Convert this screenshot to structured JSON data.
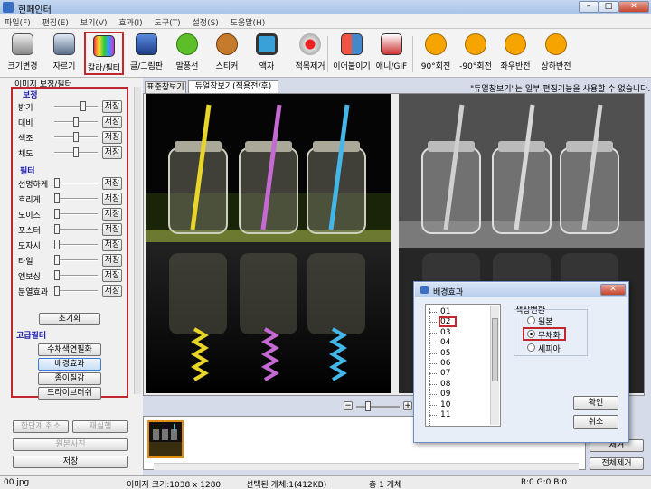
{
  "window": {
    "title": "헌페인터"
  },
  "menu": [
    "파일(F)",
    "편집(E)",
    "보기(V)",
    "효과(I)",
    "도구(T)",
    "설정(S)",
    "도움말(H)"
  ],
  "toolbar": [
    {
      "label": "크기변경",
      "icon": "resize-icon"
    },
    {
      "label": "자르기",
      "icon": "crop-icon"
    },
    {
      "label": "칼라/필터",
      "icon": "color-filter-icon"
    },
    {
      "label": "글/그림판",
      "icon": "text-draw-icon"
    },
    {
      "label": "말풍선",
      "icon": "speech-bubble-icon"
    },
    {
      "label": "스티커",
      "icon": "sticker-icon"
    },
    {
      "label": "액자",
      "icon": "frame-icon"
    },
    {
      "label": "적목제거",
      "icon": "red-eye-icon"
    },
    {
      "label": "이어붙이기",
      "icon": "merge-icon"
    },
    {
      "label": "애니/GIF",
      "icon": "gif-icon"
    },
    {
      "label": "90°회전",
      "icon": "rotate-cw-icon"
    },
    {
      "label": "-90°회전",
      "icon": "rotate-ccw-icon"
    },
    {
      "label": "좌우반전",
      "icon": "flip-h-icon"
    },
    {
      "label": "상하반전",
      "icon": "flip-v-icon"
    }
  ],
  "left_panel": {
    "header": "이미지 보정/필터",
    "correction_title": "보정",
    "correction": [
      {
        "label": "밝기",
        "level": 0.7
      },
      {
        "label": "대비",
        "level": 0.5
      },
      {
        "label": "색조",
        "level": 0.5
      },
      {
        "label": "채도",
        "level": 0.5
      }
    ],
    "filter_title": "필터",
    "filters": [
      {
        "label": "선명하게",
        "level": 0
      },
      {
        "label": "흐리게",
        "level": 0
      },
      {
        "label": "노이즈",
        "level": 0
      },
      {
        "label": "포스터",
        "level": 0
      },
      {
        "label": "모자시",
        "level": 0
      },
      {
        "label": "타일",
        "level": 0
      },
      {
        "label": "엠보싱",
        "level": 0
      },
      {
        "label": "분열효과",
        "level": 0
      }
    ],
    "apply_label": "저장",
    "reset_label": "초기화",
    "advanced_title": "고급필터",
    "advanced": [
      "수채색연필화",
      "배경효과",
      "종이질감",
      "드라이브러쉬"
    ],
    "undo_label": "한단계 취소",
    "redo_label": "재실행",
    "original_label": "원본사진",
    "save_label": "저장"
  },
  "tabs": [
    "표준창보기",
    "듀얼창보기(적용전/후)"
  ],
  "notice": "\"듀얼창보기\"는 일부 편집기능을 사용할 수 없습니다.",
  "bottom_buttons": [
    "제거",
    "전체제거"
  ],
  "status": {
    "file": "00.jpg",
    "size": "이미지 크기:1038 x 1280",
    "selected": "선택된 개체:1(412KB)",
    "total": "총 1 개체",
    "rgb": "R:0 G:0 B:0"
  },
  "dialog": {
    "title": "배경효과",
    "items": [
      "01",
      "02",
      "03",
      "04",
      "05",
      "06",
      "07",
      "08",
      "09",
      "10",
      "11"
    ],
    "selected_item": "02",
    "group_title": "색상변환",
    "options": [
      "원본",
      "무채화",
      "세피아"
    ],
    "selected_option": "무채화",
    "ok_label": "확인",
    "cancel_label": "취소"
  },
  "colors": {
    "highlight": "#c1272d",
    "section_title": "#1a1aa8",
    "thumb_border": "#e08a18"
  }
}
